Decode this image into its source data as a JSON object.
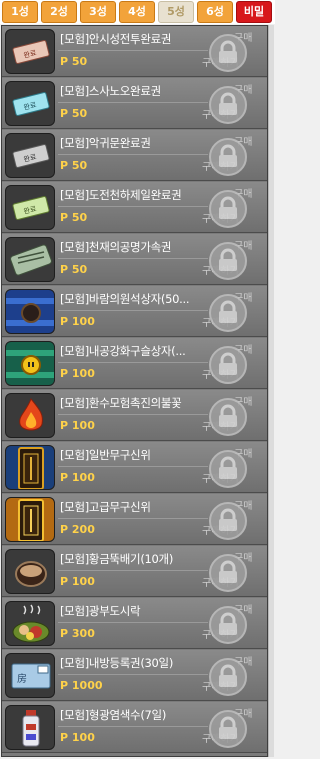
{
  "tabs": [
    {
      "label": "1성",
      "active": false
    },
    {
      "label": "2성",
      "active": false
    },
    {
      "label": "3성",
      "active": false
    },
    {
      "label": "4성",
      "active": false
    },
    {
      "label": "5성",
      "active": true
    },
    {
      "label": "6성",
      "active": false
    },
    {
      "label": "비밀",
      "active": false,
      "secret": true
    }
  ],
  "items": [
    {
      "name": "[모험]안시성전투완료권",
      "price": "P 50",
      "purchase": "구매하기",
      "status": "구매",
      "icon": "ticket-icon"
    },
    {
      "name": "[모험]스사노오완료권",
      "price": "P 50",
      "purchase": "구매하기",
      "status": "구매",
      "icon": "ticket-icon"
    },
    {
      "name": "[모험]악귀문완료권",
      "price": "P 50",
      "purchase": "구매하기",
      "status": "구매",
      "icon": "ticket-icon"
    },
    {
      "name": "[모험]도전천하제일완료권",
      "price": "P 50",
      "purchase": "구매하기",
      "status": "구매",
      "icon": "ticket-icon"
    },
    {
      "name": "[모험]천재의공명가속권",
      "price": "P 50",
      "purchase": "구매하기",
      "status": "구매",
      "icon": "scroll-icon"
    },
    {
      "name": "[모험]바람의원석상자(50...",
      "price": "P 100",
      "purchase": "구매하기",
      "status": "구매",
      "icon": "treasure-box-icon"
    },
    {
      "name": "[모험]내공강화구슬상자(...",
      "price": "P 100",
      "purchase": "구매하기",
      "status": "구매",
      "icon": "orb-box-icon"
    },
    {
      "name": "[모험]환수모험촉진의불꽃",
      "price": "P 100",
      "purchase": "구매하기",
      "status": "구매",
      "icon": "flame-icon"
    },
    {
      "name": "[모험]일반무구신위",
      "price": "P 100",
      "purchase": "구매하기",
      "status": "구매",
      "icon": "tablet-icon"
    },
    {
      "name": "[모험]고급무구신위",
      "price": "P 200",
      "purchase": "구매하기",
      "status": "구매",
      "icon": "tablet-icon"
    },
    {
      "name": "[모험]황금뚝배기(10개)",
      "price": "P 100",
      "purchase": "구매하기",
      "status": "구매",
      "icon": "bowl-icon"
    },
    {
      "name": "[모험]광부도시락",
      "price": "P 300",
      "purchase": "구매하기",
      "status": "구매",
      "icon": "lunchbox-icon"
    },
    {
      "name": "[모험]내방등록권(30일)",
      "price": "P 1000",
      "purchase": "구매하기",
      "status": "구매",
      "icon": "room-ticket-icon"
    },
    {
      "name": "[모험]형광염색수(7일)",
      "price": "P 100",
      "purchase": "구매하기",
      "status": "구매",
      "icon": "dye-bottle-icon"
    }
  ]
}
